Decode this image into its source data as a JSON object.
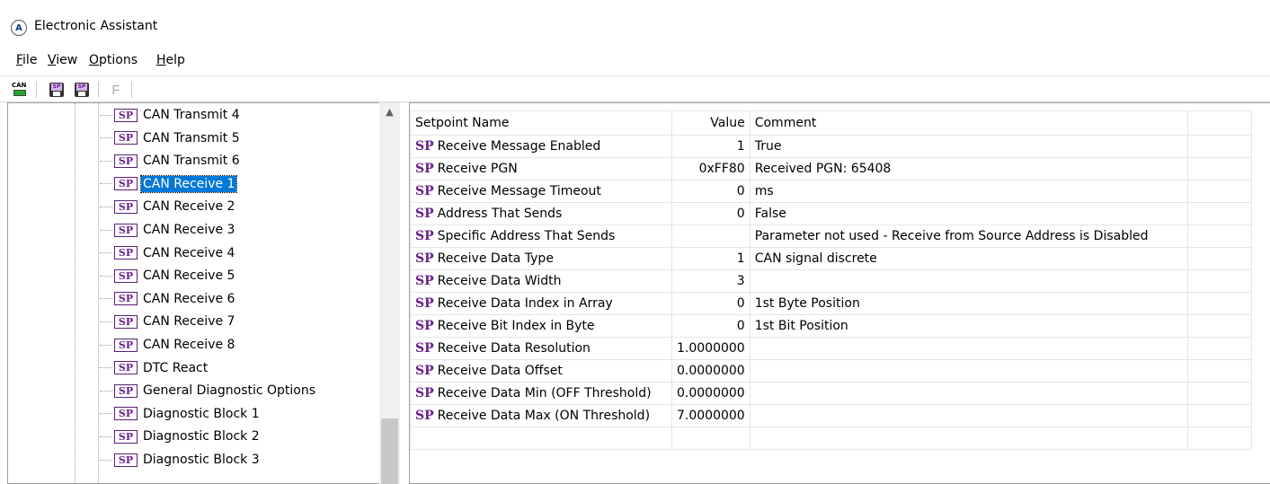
{
  "window": {
    "title": "Electronic Assistant"
  },
  "menu": [
    "File",
    "View",
    "Options",
    "Help"
  ],
  "toolbar": {
    "can_icon_text": "CAN",
    "sp_icon_text": "SP",
    "f_label": "F"
  },
  "tree": {
    "sp_badge": "SP",
    "items": [
      "CAN Transmit 4",
      "CAN Transmit 5",
      "CAN Transmit 6",
      "CAN Receive 1",
      "CAN Receive 2",
      "CAN Receive 3",
      "CAN Receive 4",
      "CAN Receive 5",
      "CAN Receive 6",
      "CAN Receive 7",
      "CAN Receive 8",
      "DTC React",
      "General Diagnostic Options",
      "Diagnostic Block 1",
      "Diagnostic Block 2",
      "Diagnostic Block 3"
    ],
    "selected": "CAN Receive 1"
  },
  "table": {
    "headers": {
      "name": "Setpoint Name",
      "value": "Value",
      "comment": "Comment"
    },
    "rows": [
      {
        "name": "Receive Message Enabled",
        "value": "1",
        "comment": "True"
      },
      {
        "name": "Receive PGN",
        "value": "0xFF80",
        "comment": "Received PGN: 65408"
      },
      {
        "name": "Receive Message Timeout",
        "value": "0",
        "comment": "ms"
      },
      {
        "name": "Address That Sends",
        "value": "0",
        "comment": "False"
      },
      {
        "name": "Specific Address That Sends",
        "value": "",
        "comment": "Parameter not used - Receive from Source Address is Disabled"
      },
      {
        "name": "Receive Data Type",
        "value": "1",
        "comment": "CAN signal discrete"
      },
      {
        "name": "Receive Data Width",
        "value": "3",
        "comment": ""
      },
      {
        "name": "Receive Data Index in Array",
        "value": "0",
        "comment": "1st Byte Position"
      },
      {
        "name": "Receive Bit Index in Byte",
        "value": "0",
        "comment": "1st Bit Position"
      },
      {
        "name": "Receive Data Resolution",
        "value": "1.0000000",
        "comment": ""
      },
      {
        "name": "Receive Data Offset",
        "value": "0.0000000",
        "comment": ""
      },
      {
        "name": "Receive Data Min (OFF Threshold)",
        "value": "0.0000000",
        "comment": ""
      },
      {
        "name": "Receive Data Max (ON Threshold)",
        "value": "7.0000000",
        "comment": ""
      }
    ]
  }
}
